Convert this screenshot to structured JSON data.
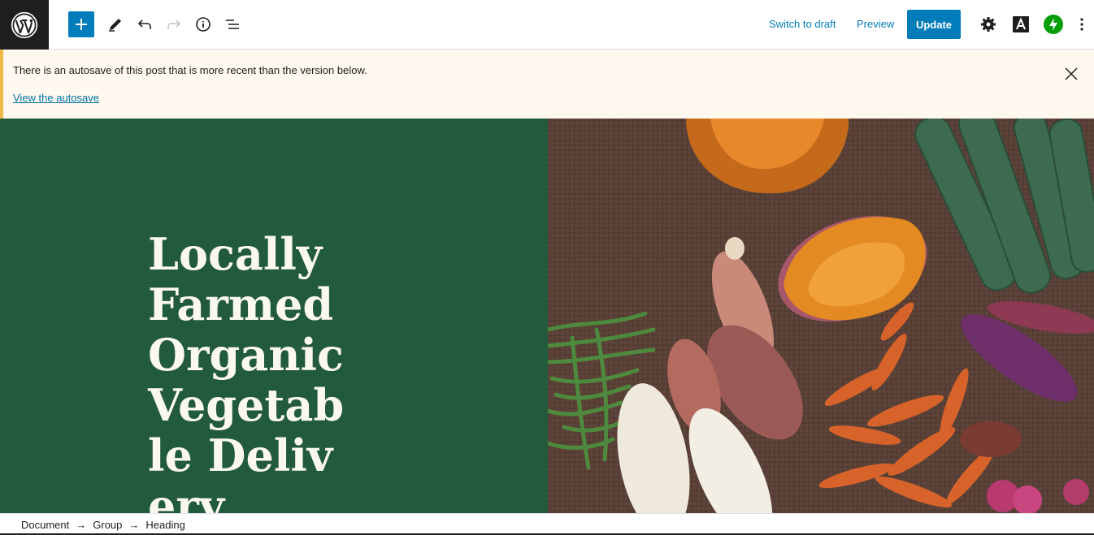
{
  "toolbar": {
    "switch_to_draft_label": "Switch to draft",
    "preview_label": "Preview",
    "update_label": "Update",
    "accent_color": "#007cba",
    "icons": [
      "wordpress-logo",
      "plus-icon",
      "pencil-icon",
      "undo-icon",
      "redo-icon",
      "info-icon",
      "list-view-icon",
      "gear-icon",
      "astra-icon",
      "jetpack-icon",
      "more-vertical-icon"
    ]
  },
  "notice": {
    "message": "There is an autosave of this post that is more recent than the version below.",
    "link_label": "View the autosave"
  },
  "hero": {
    "heading": "Locally Farmed Organic Vegetable Delivery",
    "panel_color": "#225a3c"
  },
  "breadcrumb": {
    "items": [
      "Document",
      "Group",
      "Heading"
    ],
    "separator": "→"
  }
}
